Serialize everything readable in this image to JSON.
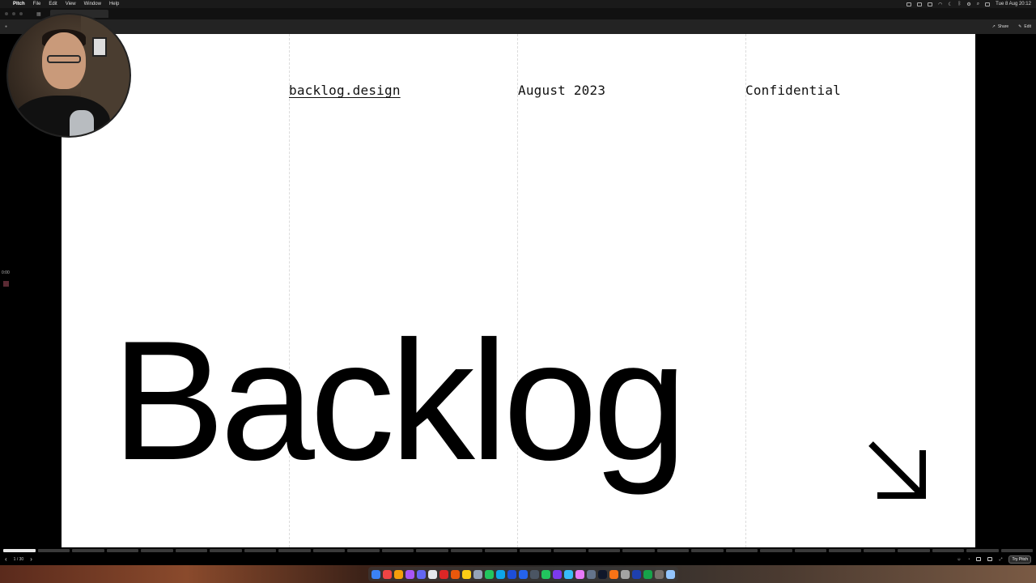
{
  "menubar": {
    "app": "Pitch",
    "items": [
      "File",
      "Edit",
      "View",
      "Window",
      "Help"
    ],
    "clock": "Tue 8 Aug 20:12"
  },
  "toolbar": {
    "share_label": "Share",
    "edit_label": "Edit"
  },
  "rail": {
    "timer": "0:00"
  },
  "slide": {
    "meta_link": "backlog.design",
    "meta_date": "August 2023",
    "meta_tag": "Confidential",
    "title": "Backlog",
    "arrow_icon": "arrow-down-right-icon"
  },
  "player": {
    "counter": "1 / 30",
    "progress": 0.033,
    "total_slides": 30,
    "try_label": "Try Pitch"
  },
  "dock": {
    "app_colors": [
      "#3b82f6",
      "#ef4444",
      "#f59e0b",
      "#a855f7",
      "#6366f1",
      "#e5e7eb",
      "#dc2626",
      "#ea580c",
      "#facc15",
      "#94a3b8",
      "#22c55e",
      "#0ea5e9",
      "#1d4ed8",
      "#2563eb",
      "#4b5563",
      "#22c55e",
      "#7c3aed",
      "#38bdf8",
      "#e879f9",
      "#64748b",
      "#0f172a",
      "#f97316",
      "#a3a3a3",
      "#1e40af",
      "#16a34a",
      "#78716c",
      "#93c5fd"
    ]
  }
}
